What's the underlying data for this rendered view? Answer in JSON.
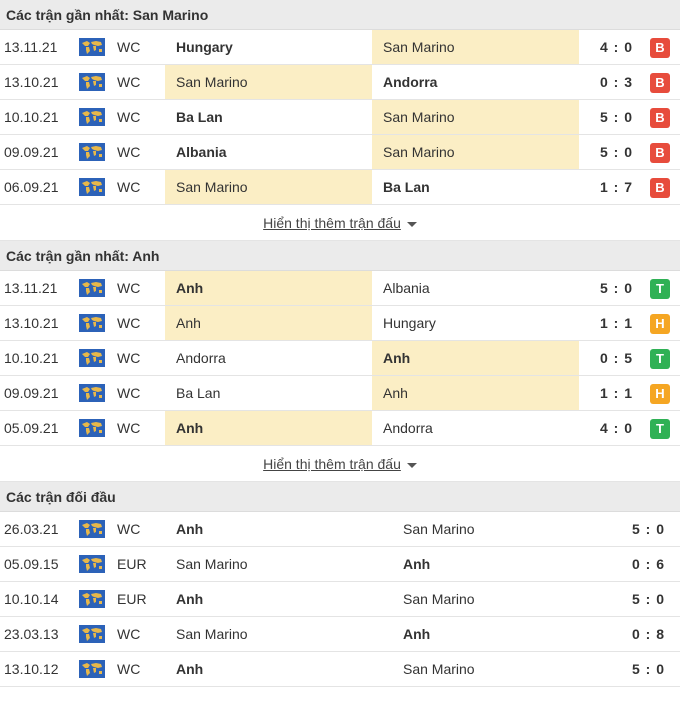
{
  "sections": [
    {
      "title": "Các trận gần nhất: San Marino",
      "more_label": "Hiển thị thêm trận đấu",
      "matches": [
        {
          "date": "13.11.21",
          "league": "WC",
          "home": "Hungary",
          "away": "San Marino",
          "score": "4 : 0",
          "result": "B",
          "home_bold": true,
          "away_bold": false,
          "hl": "away"
        },
        {
          "date": "13.10.21",
          "league": "WC",
          "home": "San Marino",
          "away": "Andorra",
          "score": "0 : 3",
          "result": "B",
          "home_bold": false,
          "away_bold": true,
          "hl": "home"
        },
        {
          "date": "10.10.21",
          "league": "WC",
          "home": "Ba Lan",
          "away": "San Marino",
          "score": "5 : 0",
          "result": "B",
          "home_bold": true,
          "away_bold": false,
          "hl": "away"
        },
        {
          "date": "09.09.21",
          "league": "WC",
          "home": "Albania",
          "away": "San Marino",
          "score": "5 : 0",
          "result": "B",
          "home_bold": true,
          "away_bold": false,
          "hl": "away"
        },
        {
          "date": "06.09.21",
          "league": "WC",
          "home": "San Marino",
          "away": "Ba Lan",
          "score": "1 : 7",
          "result": "B",
          "home_bold": false,
          "away_bold": true,
          "hl": "home"
        }
      ]
    },
    {
      "title": "Các trận gần nhất: Anh",
      "more_label": "Hiển thị thêm trận đấu",
      "matches": [
        {
          "date": "13.11.21",
          "league": "WC",
          "home": "Anh",
          "away": "Albania",
          "score": "5 : 0",
          "result": "T",
          "home_bold": true,
          "away_bold": false,
          "hl": "home"
        },
        {
          "date": "13.10.21",
          "league": "WC",
          "home": "Anh",
          "away": "Hungary",
          "score": "1 : 1",
          "result": "H",
          "home_bold": false,
          "away_bold": false,
          "hl": "home"
        },
        {
          "date": "10.10.21",
          "league": "WC",
          "home": "Andorra",
          "away": "Anh",
          "score": "0 : 5",
          "result": "T",
          "home_bold": false,
          "away_bold": true,
          "hl": "away"
        },
        {
          "date": "09.09.21",
          "league": "WC",
          "home": "Ba Lan",
          "away": "Anh",
          "score": "1 : 1",
          "result": "H",
          "home_bold": false,
          "away_bold": false,
          "hl": "away"
        },
        {
          "date": "05.09.21",
          "league": "WC",
          "home": "Anh",
          "away": "Andorra",
          "score": "4 : 0",
          "result": "T",
          "home_bold": true,
          "away_bold": false,
          "hl": "home"
        }
      ]
    }
  ],
  "h2h": {
    "title": "Các trận đối đầu",
    "matches": [
      {
        "date": "26.03.21",
        "league": "WC",
        "home": "Anh",
        "away": "San Marino",
        "score": "5 : 0",
        "home_bold": true,
        "away_bold": false
      },
      {
        "date": "05.09.15",
        "league": "EUR",
        "home": "San Marino",
        "away": "Anh",
        "score": "0 : 6",
        "home_bold": false,
        "away_bold": true
      },
      {
        "date": "10.10.14",
        "league": "EUR",
        "home": "Anh",
        "away": "San Marino",
        "score": "5 : 0",
        "home_bold": true,
        "away_bold": false
      },
      {
        "date": "23.03.13",
        "league": "WC",
        "home": "San Marino",
        "away": "Anh",
        "score": "0 : 8",
        "home_bold": false,
        "away_bold": true
      },
      {
        "date": "13.10.12",
        "league": "WC",
        "home": "Anh",
        "away": "San Marino",
        "score": "5 : 0",
        "home_bold": true,
        "away_bold": false
      }
    ]
  },
  "icons": {
    "league_flag": "world-map-flag-icon",
    "more_caret": "caret-down-icon"
  },
  "colors": {
    "win": "#2fb155",
    "draw": "#f5a623",
    "loss": "#e74c3c",
    "highlight": "#fbeec5",
    "header_bg": "#ebebeb",
    "flag_blue": "#2c62b8",
    "flag_gold": "#e8b84a"
  }
}
